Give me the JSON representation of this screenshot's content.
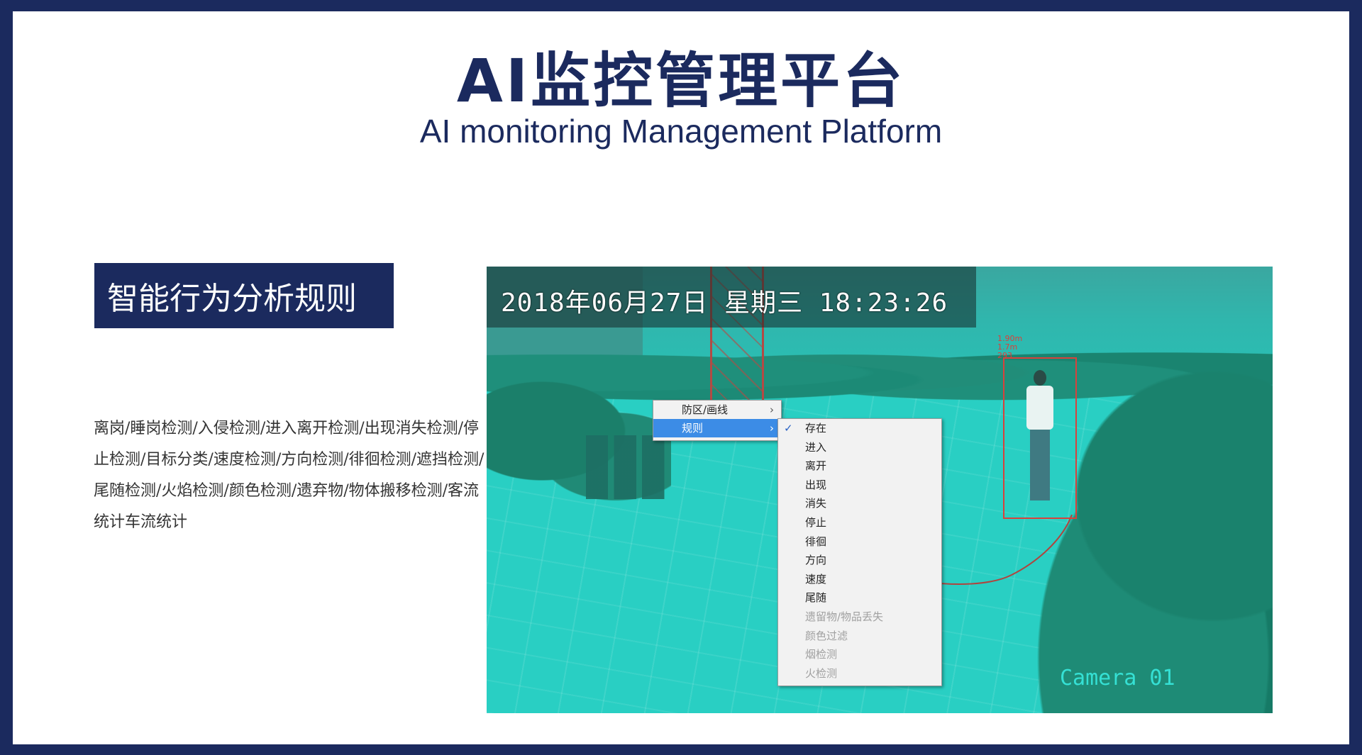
{
  "header": {
    "title_cn": "AI监控管理平台",
    "title_en": "AI monitoring Management Platform"
  },
  "section": {
    "tag": "智能行为分析规则",
    "description": "离岗/睡岗检测/入侵检测/进入离开检测/出现消失检测/停止检测/目标分类/速度检测/方向检测/徘徊检测/遮挡检测/尾随检测/火焰检测/颜色检测/遗弃物/物体搬移检测/客流统计车流统计"
  },
  "camera": {
    "osd_datetime": "2018年06月27日 星期三 18:23:26",
    "camera_label": "Camera 01",
    "object_label_lines": [
      "1.90m",
      "1.7m",
      "293"
    ],
    "box_color": "#d9413b"
  },
  "context_menu": {
    "items": [
      {
        "label": "防区/画线",
        "arrow": "›",
        "selected": false
      },
      {
        "label": "规则",
        "arrow": "›",
        "selected": true
      }
    ]
  },
  "submenu": {
    "items": [
      {
        "label": "存在",
        "checked": true,
        "disabled": false
      },
      {
        "label": "进入",
        "checked": false,
        "disabled": false
      },
      {
        "label": "离开",
        "checked": false,
        "disabled": false
      },
      {
        "label": "出现",
        "checked": false,
        "disabled": false
      },
      {
        "label": "消失",
        "checked": false,
        "disabled": false
      },
      {
        "label": "停止",
        "checked": false,
        "disabled": false
      },
      {
        "label": "徘徊",
        "checked": false,
        "disabled": false
      },
      {
        "label": "方向",
        "checked": false,
        "disabled": false
      },
      {
        "label": "速度",
        "checked": false,
        "disabled": false
      },
      {
        "label": "尾随",
        "checked": false,
        "disabled": false
      },
      {
        "label": "遗留物/物品丢失",
        "checked": false,
        "disabled": true
      },
      {
        "label": "颜色过滤",
        "checked": false,
        "disabled": true
      },
      {
        "label": "烟检测",
        "checked": false,
        "disabled": true
      },
      {
        "label": "火检测",
        "checked": false,
        "disabled": true
      }
    ],
    "check_icon": "checkmark-icon"
  },
  "colors": {
    "navy": "#1b2a5e",
    "menu_highlight": "#3c8ce6",
    "camera_tint": "#29cfc3"
  }
}
